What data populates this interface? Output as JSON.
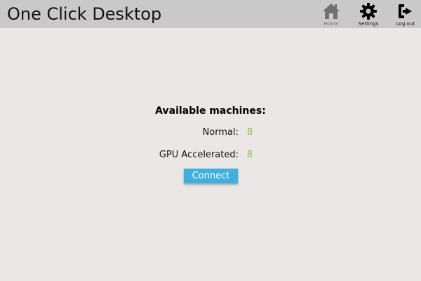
{
  "header": {
    "title": "One Click Desktop",
    "nav": [
      {
        "label": "Home",
        "icon": "home-icon"
      },
      {
        "label": "Settings",
        "icon": "gear-icon"
      },
      {
        "label": "Log out",
        "icon": "logout-icon"
      }
    ]
  },
  "main": {
    "heading": "Available machines:",
    "stats": [
      {
        "label": "Normal:",
        "value": "8"
      },
      {
        "label": "GPU Accelerated:",
        "value": "8"
      }
    ],
    "connect_label": "Connect"
  },
  "colors": {
    "background": "#ebe7e7",
    "topbar": "#c9c9c9",
    "accent": "#3fb0de",
    "value_green": "#8bc34a"
  }
}
